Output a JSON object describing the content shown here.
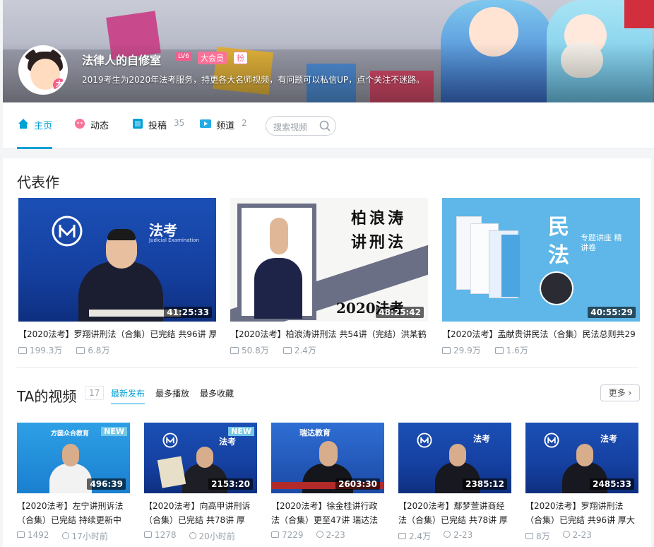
{
  "profile": {
    "name": "法律人的自修室",
    "level": "LV6",
    "vip": "大会员",
    "fan": "粉",
    "avatar_badge": "大",
    "sign": "2019考生为2020年法考服务，持更各大名师视频，有问题可以私信UP，点个关注不迷路。"
  },
  "nav": {
    "home": "主页",
    "dynamic": "动态",
    "submit": "投稿",
    "submit_count": "35",
    "channel": "频道",
    "channel_count": "2",
    "search_placeholder": "搜索视频"
  },
  "masterpiece": {
    "title": "代表作",
    "items": [
      {
        "thumb_text": "法考",
        "thumb_sub": "Judicial Examination",
        "duration": "41:25:33",
        "title": "【2020法考】罗翔讲刑法（合集）已完结 共96讲 厚",
        "views": "199.3万",
        "danmaku": "6.8万"
      },
      {
        "thumb_text": "柏浪涛讲刑法",
        "thumb_sub": "2020法考",
        "duration": "48:25:42",
        "title": "【2020法考】柏浪涛讲刑法 共54讲（完结）洪某鹤",
        "views": "50.8万",
        "danmaku": "2.4万"
      },
      {
        "thumb_text": "民法",
        "thumb_sub": "专题讲座 精讲卷",
        "duration": "40:55:29",
        "title": "【2020法考】孟献贵讲民法（合集）民法总则共29",
        "views": "29.9万",
        "danmaku": "1.6万"
      }
    ]
  },
  "videos": {
    "title": "TA的视频",
    "count": "17",
    "sort_latest": "最新发布",
    "sort_play": "最多播放",
    "sort_fav": "最多收藏",
    "more": "更多",
    "new_label": "NEW",
    "items": [
      {
        "brand": "方圆众合教育",
        "duration": "496:39",
        "title": "【2020法考】左宁讲刑诉法（合集）已完结 持续更新中",
        "views": "1492",
        "time": "17小时前",
        "is_new": true
      },
      {
        "brand": "法考",
        "duration": "2153:20",
        "title": "【2020法考】向高甲讲刑诉（合集）已完结 共78讲 厚",
        "views": "1278",
        "time": "20小时前",
        "is_new": true
      },
      {
        "brand": "瑞达教育",
        "duration": "2603:30",
        "title": "【2020法考】徐金桂讲行政法（合集）更至47讲 瑞达法",
        "views": "7229",
        "time": "2-23",
        "is_new": false
      },
      {
        "brand": "法考",
        "duration": "2385:12",
        "title": "【2020法考】鄢梦萱讲商经法（合集）已完结 共78讲 厚",
        "views": "2.4万",
        "time": "2-23",
        "is_new": false
      },
      {
        "brand": "法考",
        "duration": "2485:33",
        "title": "【2020法考】罗翔讲刑法（合集）已完结 共96讲 厚大",
        "views": "8万",
        "time": "2-23",
        "is_new": false
      }
    ]
  },
  "colors": {
    "accent": "#00a1d6",
    "pink": "#fb7299"
  }
}
